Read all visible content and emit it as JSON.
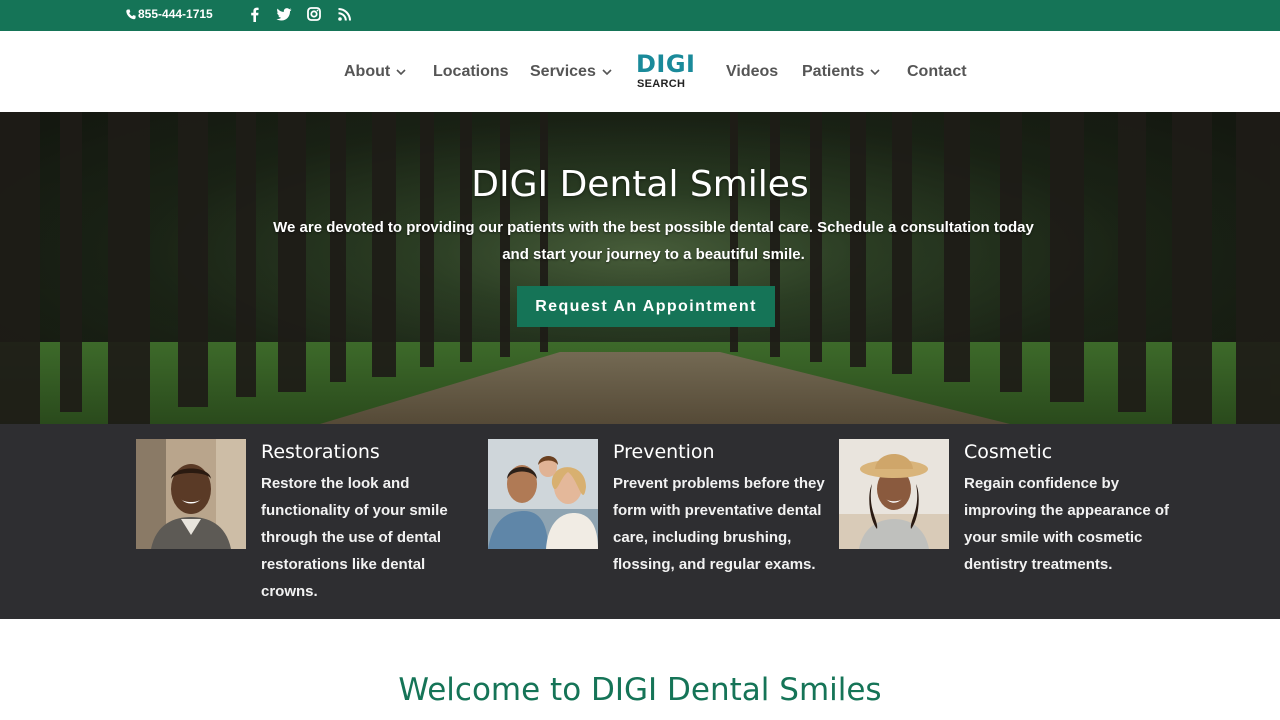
{
  "topbar": {
    "phone": "855-444-1715",
    "social_icons": [
      "facebook-icon",
      "twitter-icon",
      "instagram-icon",
      "rss-icon"
    ],
    "bg_color": "#157457"
  },
  "nav": {
    "items": [
      {
        "label": "About",
        "has_dropdown": true
      },
      {
        "label": "Locations",
        "has_dropdown": false
      },
      {
        "label": "Services",
        "has_dropdown": true
      },
      {
        "label": "Videos",
        "has_dropdown": false
      },
      {
        "label": "Patients",
        "has_dropdown": true
      },
      {
        "label": "Contact",
        "has_dropdown": false
      }
    ],
    "logo": {
      "line1": "DIGI",
      "line2": "SEARCH"
    }
  },
  "hero": {
    "title": "DIGI Dental Smiles",
    "text": "We are devoted to providing our patients with the best possible dental care. Schedule a consultation today and start your journey to a beautiful smile.",
    "button": "Request An Appointment"
  },
  "services": [
    {
      "title": "Restorations",
      "description": "Restore the look and functionality of your smile through the use of dental restorations like dental crowns."
    },
    {
      "title": "Prevention",
      "description": "Prevent problems before they form with preventative dental care, including brushing, flossing, and regular exams."
    },
    {
      "title": "Cosmetic",
      "description": "Regain confidence by improving the appearance of your smile with cosmetic dentistry treatments."
    }
  ],
  "welcome": {
    "heading": "Welcome to DIGI Dental Smiles"
  },
  "colors": {
    "brand_green": "#157457",
    "services_bg": "#2e2e31",
    "logo_teal": "#1a8a9a"
  }
}
